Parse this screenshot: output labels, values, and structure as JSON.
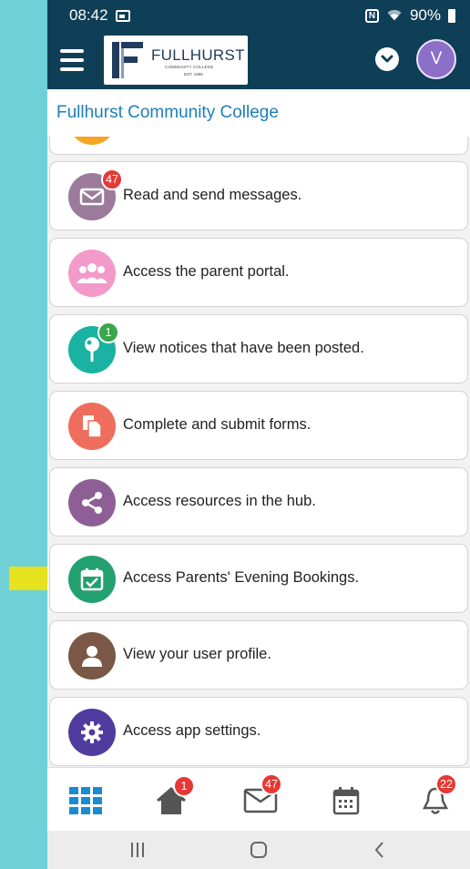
{
  "status_bar": {
    "time": "08:42",
    "battery": "90%"
  },
  "app_bar": {
    "logo_name": "FULLHURST",
    "logo_sub": "COMMUNITY COLLEGE",
    "logo_est": "EST. 1955",
    "avatar_letter": "V"
  },
  "title": "Fullhurst Community College",
  "items": [
    {
      "label": "Read and send messages.",
      "icon": "envelope-icon",
      "color": "#9b7a9b",
      "badge": "47"
    },
    {
      "label": "Access the parent portal.",
      "icon": "people-icon",
      "color": "#f29ac9"
    },
    {
      "label": "View notices that have been posted.",
      "icon": "pushpin-icon",
      "color": "#1ab2a3",
      "badge": "1"
    },
    {
      "label": "Complete and submit forms.",
      "icon": "documents-icon",
      "color": "#ef6d5c"
    },
    {
      "label": "Access resources in the hub.",
      "icon": "share-icon",
      "color": "#8e5f96"
    },
    {
      "label": "Access Parents' Evening Bookings.",
      "icon": "calendar-check-icon",
      "color": "#23a06f"
    },
    {
      "label": "View your user profile.",
      "icon": "user-icon",
      "color": "#7a5845"
    },
    {
      "label": "Access app settings.",
      "icon": "gear-icon",
      "color": "#4f3c9e"
    }
  ],
  "bottom_nav": {
    "home_badge": "1",
    "messages_badge": "47",
    "notifications_badge": "22",
    "active_color": "#1a8ad1"
  }
}
